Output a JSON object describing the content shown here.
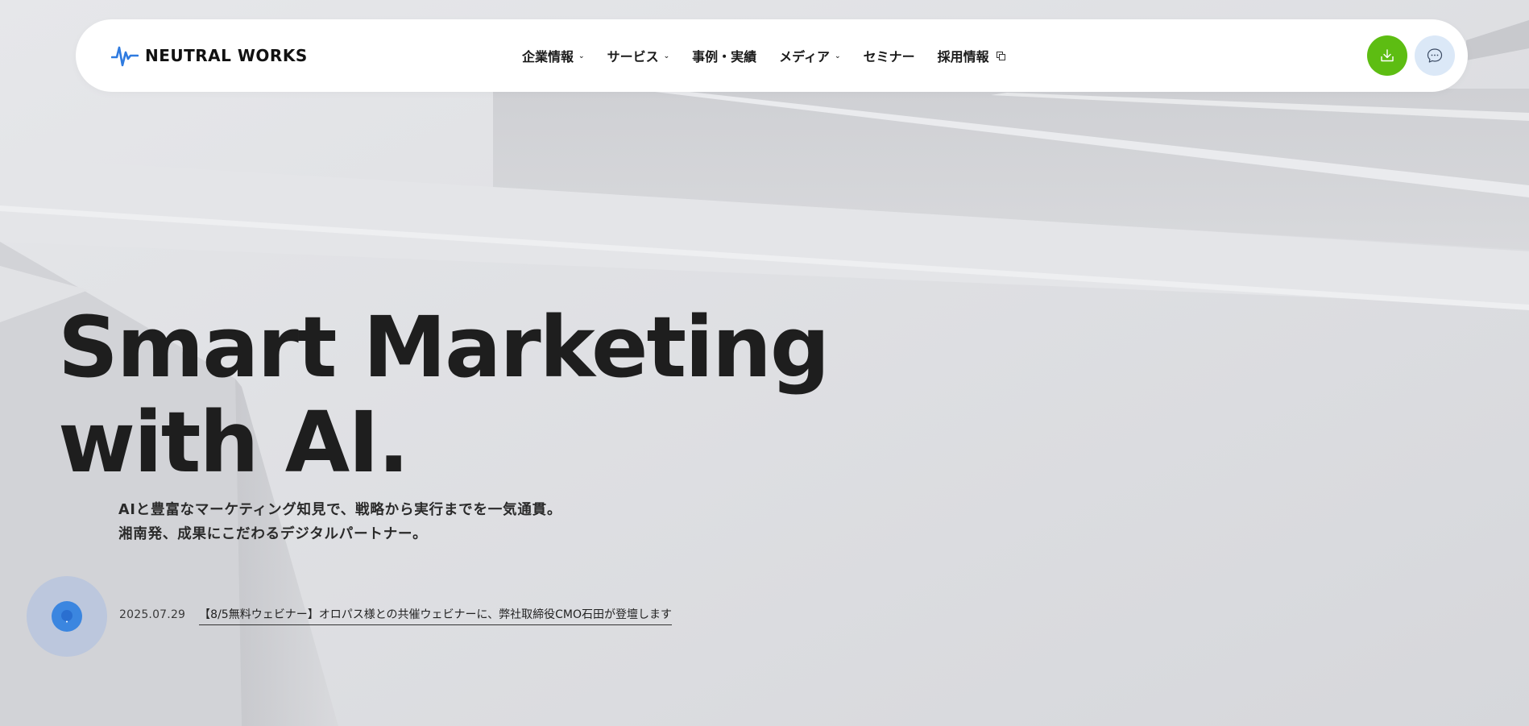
{
  "brand": {
    "name": "NEUTRAL WORKS",
    "accent_color": "#2f7be0"
  },
  "nav": {
    "items": [
      {
        "label": "企業情報",
        "has_dropdown": true
      },
      {
        "label": "サービス",
        "has_dropdown": true
      },
      {
        "label": "事例・実績",
        "has_dropdown": false
      },
      {
        "label": "メディア",
        "has_dropdown": true
      },
      {
        "label": "セミナー",
        "has_dropdown": false
      },
      {
        "label": "採用情報",
        "has_dropdown": false,
        "external": true
      }
    ],
    "download_button_color": "#5dbd12",
    "chat_button_color": "#dbe8f7"
  },
  "hero": {
    "title_line1": "Smart Marketing",
    "title_line2": "with AI.",
    "subtitle_line1": "AIと豊富なマーケティング知見で、戦略から実行までを一気通貫。",
    "subtitle_line2": "湘南発、成果にこだわるデジタルパートナー。"
  },
  "news": {
    "date": "2025.07.29",
    "headline": "【8/5無料ウェビナー】オロパス様との共催ウェビナーに、弊社取締役CMO石田が登壇します"
  },
  "icons": {
    "logo": "waveform-icon",
    "dropdown": "chevron-down-icon",
    "external": "external-link-icon",
    "download": "download-icon",
    "chat": "chat-bubble-icon",
    "floating": "chat-widget-icon"
  }
}
